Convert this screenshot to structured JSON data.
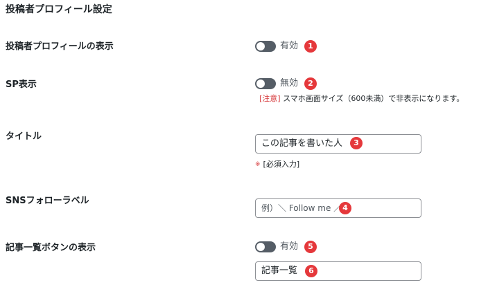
{
  "section": {
    "title": "投稿者プロフィール設定"
  },
  "rows": {
    "profile_display": {
      "label": "投稿者プロフィールの表示",
      "toggle_text": "有効",
      "badge": "1"
    },
    "sp_display": {
      "label": "SP表示",
      "toggle_text": "無効",
      "badge": "2",
      "note_tag": "[注意]",
      "note_text": "スマホ画面サイズ（600未満）で非表示になります。"
    },
    "title": {
      "label": "タイトル",
      "value": "この記事を書いた人",
      "badge": "3",
      "required_mark": "※",
      "required_text": "[必須入力]"
    },
    "sns_label": {
      "label": "SNSフォローラベル",
      "placeholder": "例）＼ Follow me ／",
      "badge": "4"
    },
    "list_button": {
      "label": "記事一覧ボタンの表示",
      "toggle_text": "有効",
      "badge": "5",
      "value": "記事一覧",
      "badge2": "6"
    }
  },
  "colors": {
    "toggle": "#555d66",
    "badge": "#e5383b",
    "warning": "#d63638",
    "input_border": "#8c8f94"
  }
}
